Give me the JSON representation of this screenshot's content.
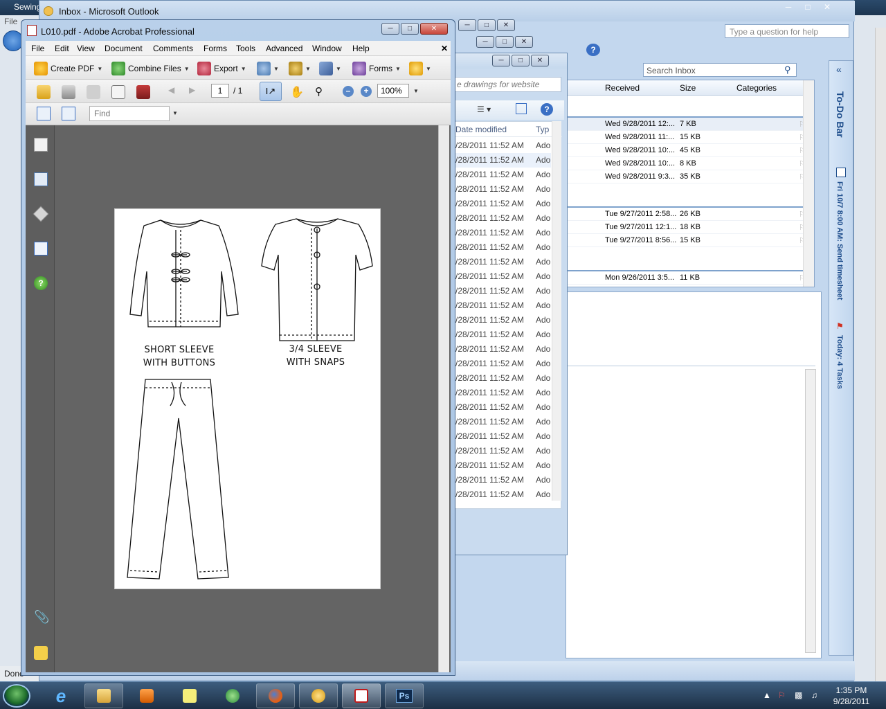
{
  "firefox": {
    "title": "Sewing",
    "menu_file": "File",
    "status": "Done"
  },
  "outlook": {
    "title": "Inbox - Microsoft Outlook",
    "help_placeholder": "Type a question for help",
    "search_placeholder": "Search Inbox",
    "columns": {
      "received": "Received",
      "size": "Size",
      "categories": "Categories"
    },
    "messages": [
      {
        "received": "Wed 9/28/2011 12:...",
        "size": "7 KB"
      },
      {
        "received": "Wed 9/28/2011 11:...",
        "size": "15 KB"
      },
      {
        "received": "Wed 9/28/2011 10:...",
        "size": "45 KB"
      },
      {
        "received": "Wed 9/28/2011 10:...",
        "size": "8 KB"
      },
      {
        "received": "Wed 9/28/2011 9:3...",
        "size": "35 KB"
      },
      {
        "received": "Tue 9/27/2011 2:58...",
        "size": "26 KB"
      },
      {
        "received": "Tue 9/27/2011 12:1...",
        "size": "18 KB"
      },
      {
        "received": "Tue 9/27/2011 8:56...",
        "size": "15 KB"
      },
      {
        "received": "Mon 9/26/2011 3:5...",
        "size": "11 KB"
      }
    ],
    "todo_bar": "To-Do Bar",
    "todo_appt": "Fri 10/7 8:00 AM: Send timesheet",
    "todo_tasks": "Today: 4 Tasks"
  },
  "explorer": {
    "search_placeholder": "e drawings for website",
    "col_date": "Date modified",
    "col_type": "Typ",
    "file_date": "/28/2011 11:52 AM",
    "file_type": "Ado"
  },
  "acrobat": {
    "title": "L010.pdf - Adobe Acrobat Professional",
    "menu": [
      "File",
      "Edit",
      "View",
      "Document",
      "Comments",
      "Forms",
      "Tools",
      "Advanced",
      "Window",
      "Help"
    ],
    "tb_create_pdf": "Create PDF",
    "tb_combine": "Combine Files",
    "tb_export": "Export",
    "tb_forms": "Forms",
    "page_current": "1",
    "page_total": "/ 1",
    "zoom": "100%",
    "find_placeholder": "Find",
    "pdf_captions": {
      "short_line1": "SHORT SLEEVE",
      "short_line2": "WITH BUTTONS",
      "threequarter_line1": "3/4 SLEEVE",
      "threequarter_line2": "WITH SNAPS"
    }
  },
  "taskbar": {
    "time": "1:35 PM",
    "date": "9/28/2011",
    "ps_label": "Ps"
  },
  "colors": {
    "outlook_chrome": "#c3d7ee",
    "acrobat_canvas": "#646464",
    "taskbar": "#1c2f45"
  }
}
